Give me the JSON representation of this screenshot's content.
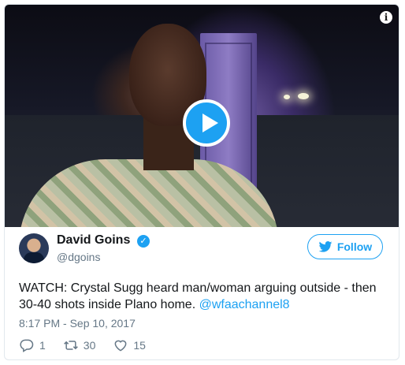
{
  "tweet": {
    "author_name": "David Goins",
    "author_handle": "@dgoins",
    "follow_label": "Follow",
    "text": "WATCH: Crystal Sugg heard man/woman arguing outside - then 30-40 shots inside Plano home. ",
    "mention": "@wfaachannel8",
    "timestamp": "8:17 PM - Sep 10, 2017",
    "reply_count": "1",
    "retweet_count": "30",
    "like_count": "15"
  },
  "icons": {
    "info": "info-icon",
    "play": "play-icon",
    "verified": "verified-badge-icon",
    "twitter": "twitter-bird-icon",
    "reply": "reply-icon",
    "retweet": "retweet-icon",
    "like": "heart-icon"
  },
  "colors": {
    "accent": "#1da1f2",
    "text": "#14171a",
    "muted": "#657786"
  }
}
